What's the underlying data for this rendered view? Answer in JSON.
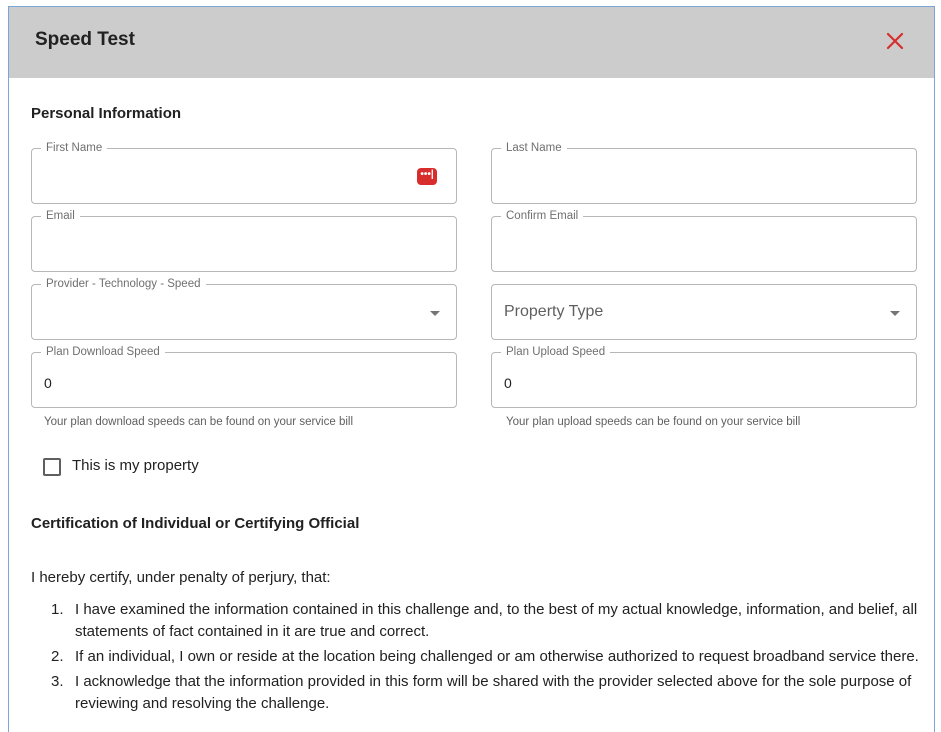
{
  "dialog": {
    "title": "Speed Test",
    "close_glyph": "✕"
  },
  "personal": {
    "section_title": "Personal Information"
  },
  "fields": {
    "first_name": {
      "label": "First Name",
      "value": "",
      "icon": "password-manager-icon",
      "icon_glyph": "•••|"
    },
    "last_name": {
      "label": "Last Name",
      "value": ""
    },
    "email": {
      "label": "Email",
      "value": ""
    },
    "confirm_email": {
      "label": "Confirm Email",
      "value": ""
    },
    "provider": {
      "label": "Provider - Technology - Speed",
      "value": ""
    },
    "property_type": {
      "placeholder": "Property Type"
    },
    "plan_download": {
      "label": "Plan Download Speed",
      "value": "0",
      "helper": "Your plan download speeds can be found on your service bill"
    },
    "plan_upload": {
      "label": "Plan Upload Speed",
      "value": "0",
      "helper": "Your plan upload speeds can be found on your service bill"
    }
  },
  "property_checkbox": {
    "label": "This is my property",
    "checked": false
  },
  "certification": {
    "section_title": "Certification of Individual or Certifying Official",
    "intro": "I hereby certify, under penalty of perjury, that:",
    "items": [
      {
        "num": "1.",
        "text": "I have examined the information contained in this challenge and, to the best of my actual knowledge, information, and belief, all statements of fact contained in it are true and correct."
      },
      {
        "num": "2.",
        "text": "If an individual, I own or reside at the location being challenged or am otherwise authorized to request broadband service there."
      },
      {
        "num": "3.",
        "text": "I acknowledge that the information provided in this form will be shared with the provider selected above for the sole purpose of reviewing and resolving the challenge."
      }
    ]
  },
  "colors": {
    "header_bg": "#cccccc",
    "close": "#d82d2d",
    "field_border": "#b7b7b7"
  }
}
